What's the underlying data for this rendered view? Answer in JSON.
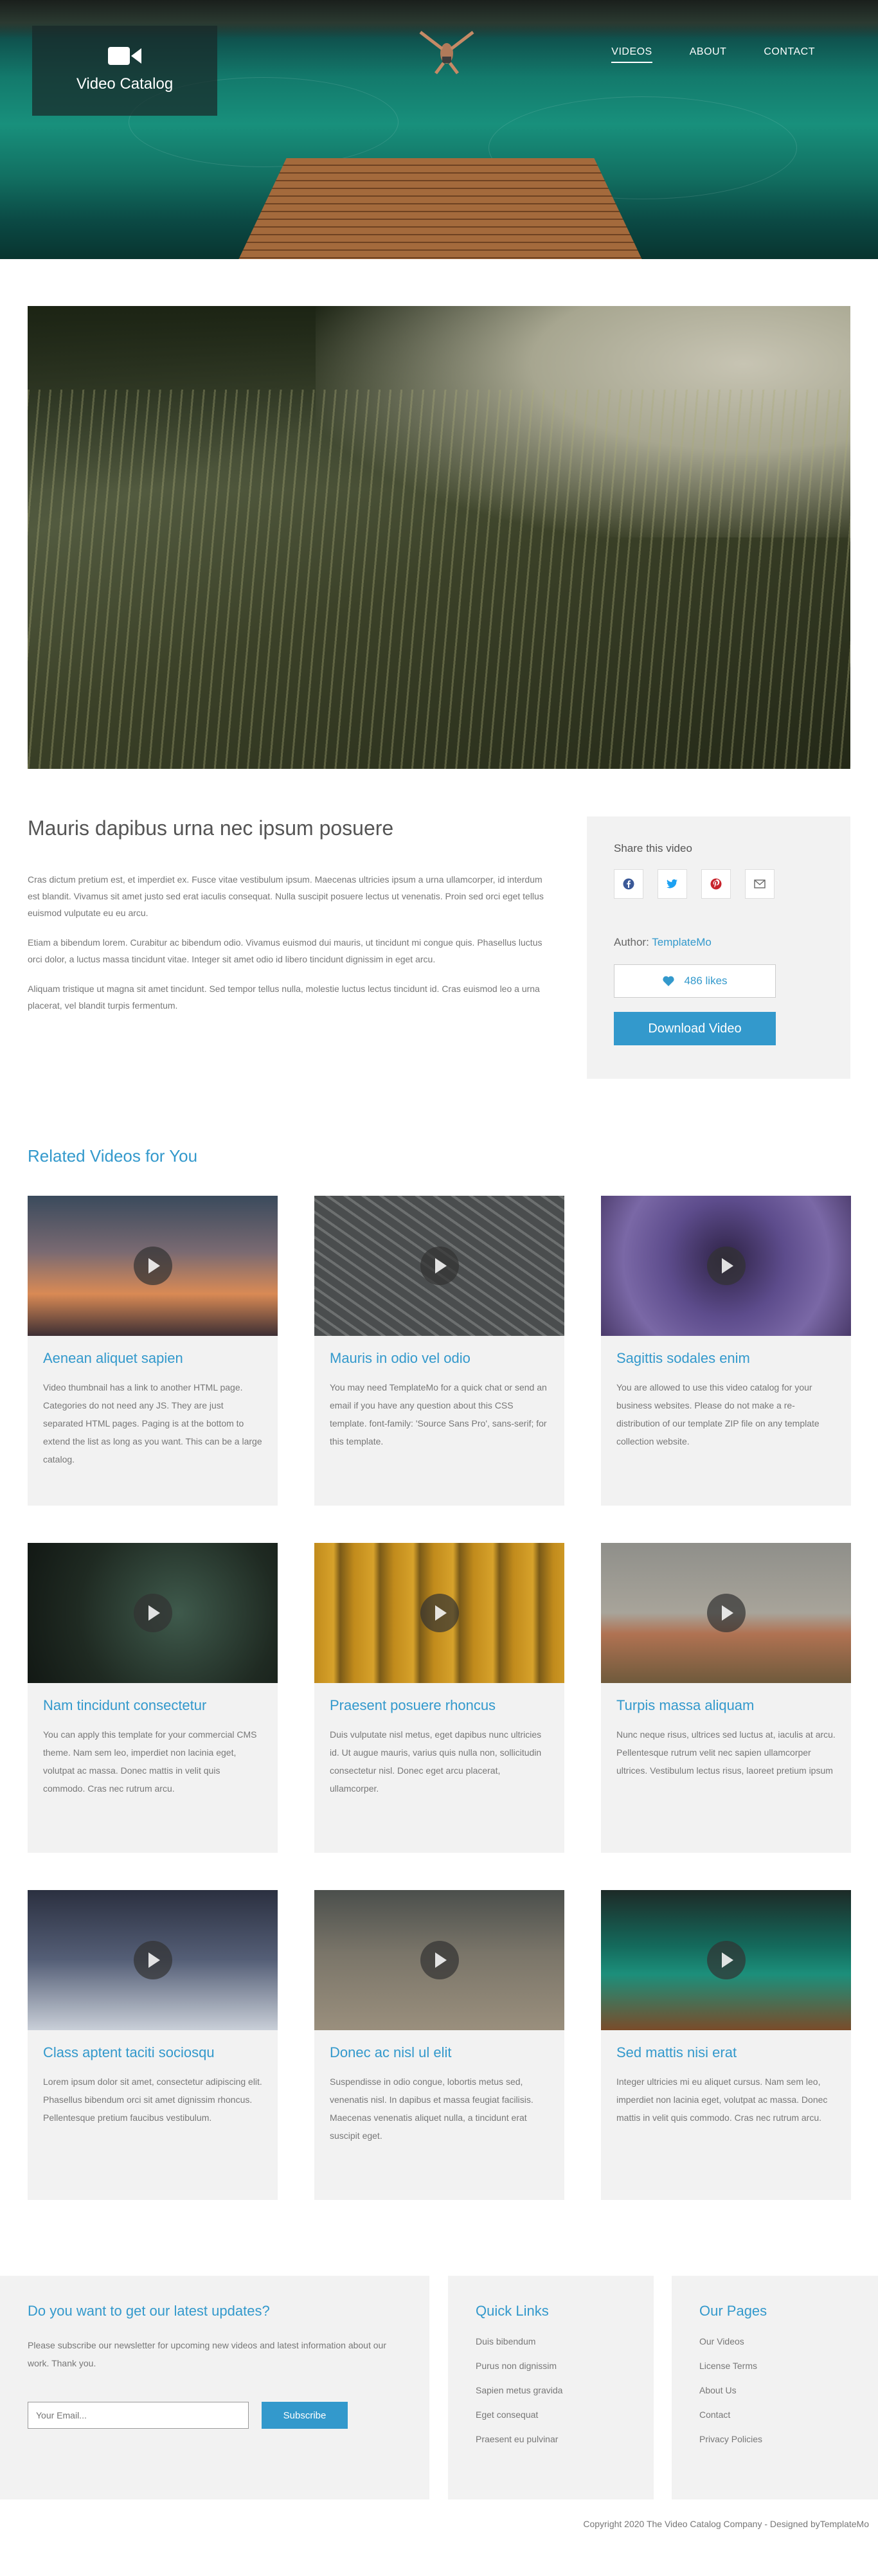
{
  "header": {
    "brand_title": "Video Catalog",
    "nav": [
      {
        "label": "VIDEOS",
        "active": true
      },
      {
        "label": "ABOUT",
        "active": false
      },
      {
        "label": "CONTACT",
        "active": false
      }
    ]
  },
  "video": {
    "title": "Mauris dapibus urna nec ipsum posuere",
    "paragraphs": [
      "Cras dictum pretium est, et imperdiet ex. Fusce vitae vestibulum ipsum. Maecenas ultricies ipsum a urna ullamcorper, id interdum est blandit. Vivamus sit amet justo sed erat iaculis consequat. Nulla suscipit posuere lectus ut venenatis. Proin sed orci eget tellus euismod vulputate eu eu arcu.",
      "Etiam a bibendum lorem. Curabitur ac bibendum odio. Vivamus euismod dui mauris, ut tincidunt mi congue quis. Phasellus luctus orci dolor, a luctus massa tincidunt vitae. Integer sit amet odio id libero tincidunt dignissim in eget arcu.",
      "Aliquam tristique ut magna sit amet tincidunt. Sed tempor tellus nulla, molestie luctus lectus tincidunt id. Cras euismod leo a urna placerat, vel blandit turpis fermentum."
    ]
  },
  "sidebar": {
    "share_label": "Share this video",
    "share_icons": [
      "facebook-icon",
      "twitter-icon",
      "pinterest-icon",
      "envelope-icon"
    ],
    "author_label": "Author:",
    "author_name": "TemplateMo",
    "likes": "486 likes",
    "download_label": "Download Video"
  },
  "related": {
    "title": "Related Videos for You",
    "items": [
      {
        "title": "Aenean aliquet sapien",
        "text": "Video thumbnail has a link to another HTML page. Categories do not need any JS. They are just separated HTML pages. Paging is at the bottom to extend the list as long as you want. This can be a large catalog."
      },
      {
        "title": "Mauris in odio vel odio",
        "text": "You may need TemplateMo for a quick chat or send an email if you have any question about this CSS template. font-family: 'Source Sans Pro', sans-serif; for this template."
      },
      {
        "title": "Sagittis sodales enim",
        "text": "You are allowed to use this video catalog for your business websites. Please do not make a re-distribution of our template ZIP file on any template collection website."
      },
      {
        "title": "Nam tincidunt consectetur",
        "text": "You can apply this template for your commercial CMS theme. Nam sem leo, imperdiet non lacinia eget, volutpat ac massa. Donec mattis in velit quis commodo. Cras nec rutrum arcu."
      },
      {
        "title": "Praesent posuere rhoncus",
        "text": "Duis vulputate nisl metus, eget dapibus nunc ultricies id. Ut augue mauris, varius quis nulla non, sollicitudin consectetur nisl. Donec eget arcu placerat, ullamcorper."
      },
      {
        "title": "Turpis massa aliquam",
        "text": "Nunc neque risus, ultrices sed luctus at, iaculis at arcu. Pellentesque rutrum velit nec sapien ullamcorper ultrices. Vestibulum lectus risus, laoreet pretium ipsum"
      },
      {
        "title": "Class aptent taciti sociosqu",
        "text": "Lorem ipsum dolor sit amet, consectetur adipiscing elit. Phasellus bibendum orci sit amet dignissim rhoncus. Pellentesque pretium faucibus vestibulum."
      },
      {
        "title": "Donec ac nisl ul elit",
        "text": "Suspendisse in odio congue, lobortis metus sed, venenatis nisl. In dapibus et massa feugiat facilisis. Maecenas venenatis aliquet nulla, a tincidunt erat suscipit eget."
      },
      {
        "title": "Sed mattis nisi erat",
        "text": "Integer ultricies mi eu aliquet cursus. Nam sem leo, imperdiet non lacinia eget, volutpat ac massa. Donec mattis in velit quis commodo. Cras nec rutrum arcu."
      }
    ]
  },
  "footer": {
    "newsletter_title": "Do you want to get our latest updates?",
    "newsletter_text": "Please subscribe our newsletter for upcoming new videos and latest information about our work. Thank you.",
    "email_placeholder": "Your Email...",
    "subscribe_label": "Subscribe",
    "quick_links_title": "Quick Links",
    "quick_links": [
      "Duis bibendum",
      "Purus non dignissim",
      "Sapien metus gravida",
      "Eget consequat",
      "Praesent eu pulvinar"
    ],
    "our_pages_title": "Our Pages",
    "our_pages": [
      "Our Videos",
      "License Terms",
      "About Us",
      "Contact",
      "Privacy Policies"
    ],
    "copyright": "Copyright 2020 The Video Catalog Company - Designed byTemplateMo"
  },
  "colors": {
    "accent": "#3399cc",
    "panel": "#f2f2f2",
    "text": "#777777"
  }
}
